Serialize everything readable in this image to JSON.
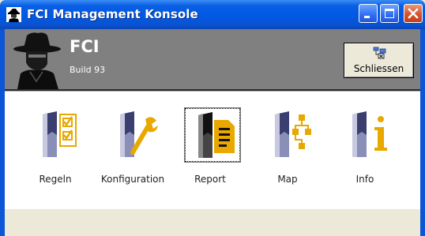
{
  "window": {
    "title": "FCI Management Konsole",
    "icon": "spy-icon",
    "controls": [
      "minimize-icon",
      "maximize-icon",
      "close-icon"
    ]
  },
  "header": {
    "title": "FCI",
    "build": "Build 93",
    "close_button_label": "Schliessen",
    "close_button_icon": "network-close-icon"
  },
  "tools": [
    {
      "label": "Regeln",
      "icon": "checklist-icon",
      "selected": false
    },
    {
      "label": "Konfiguration",
      "icon": "wrench-icon",
      "selected": false
    },
    {
      "label": "Report",
      "icon": "document-icon",
      "selected": true
    },
    {
      "label": "Map",
      "icon": "hierarchy-icon",
      "selected": false
    },
    {
      "label": "Info",
      "icon": "info-icon",
      "selected": false
    }
  ],
  "colors": {
    "accent": "#e8a800",
    "header_bg": "#808080",
    "titlebar": "#0058e6"
  }
}
